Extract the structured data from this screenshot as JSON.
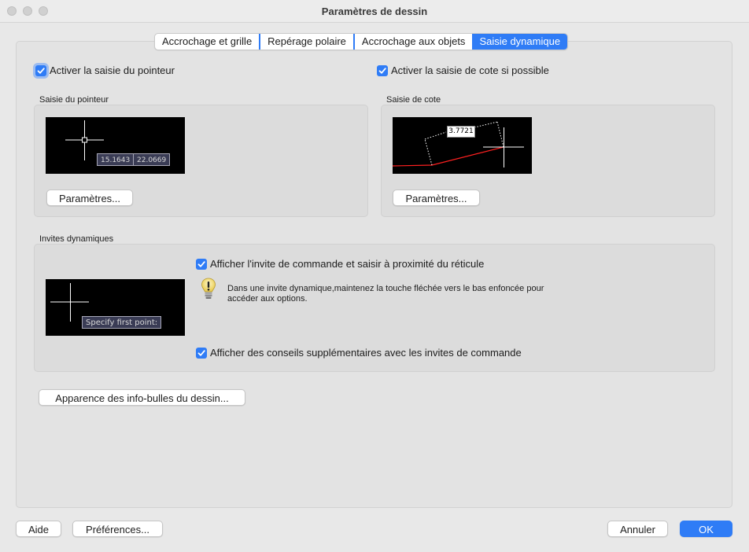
{
  "window": {
    "title": "Paramètres de dessin"
  },
  "tabs": [
    {
      "label": "Accrochage et grille",
      "active": false
    },
    {
      "label": "Repérage polaire",
      "active": false
    },
    {
      "label": "Accrochage aux objets",
      "active": false
    },
    {
      "label": "Saisie dynamique",
      "active": true
    }
  ],
  "pointer_input": {
    "checkbox_label": "Activer la saisie du pointeur",
    "checked": true,
    "section_title": "Saisie du pointeur",
    "preview": {
      "x_value": "15.1643",
      "y_value": "22.0669"
    },
    "settings_button": "Paramètres..."
  },
  "dimension_input": {
    "checkbox_label": "Activer la saisie de cote si possible",
    "checked": true,
    "section_title": "Saisie de cote",
    "preview": {
      "value": "3.7721"
    },
    "settings_button": "Paramètres..."
  },
  "dynamic_prompts": {
    "section_title": "Invites dynamiques",
    "show_prompt_label": "Afficher l'invite de commande et saisir à proximité du réticule",
    "show_prompt_checked": true,
    "tip_text_line1": "Dans une invite dynamique,maintenez la touche fléchée vers le bas enfoncée pour",
    "tip_text_line2": "accéder aux options.",
    "preview_prompt": "Specify first point:",
    "extra_tips_label": "Afficher des conseils supplémentaires avec les invites de commande",
    "extra_tips_checked": true
  },
  "tooltip_appearance_button": "Apparence des info-bulles du dessin...",
  "footer": {
    "help_button": "Aide",
    "preferences_button": "Préférences...",
    "cancel_button": "Annuler",
    "ok_button": "OK"
  },
  "colors": {
    "accent": "#2f7cf6",
    "preview_bg": "#000000",
    "rubber_band": "#ff2020"
  },
  "icons": {
    "tip": "lightbulb-icon",
    "checkbox": "checkmark-icon"
  }
}
